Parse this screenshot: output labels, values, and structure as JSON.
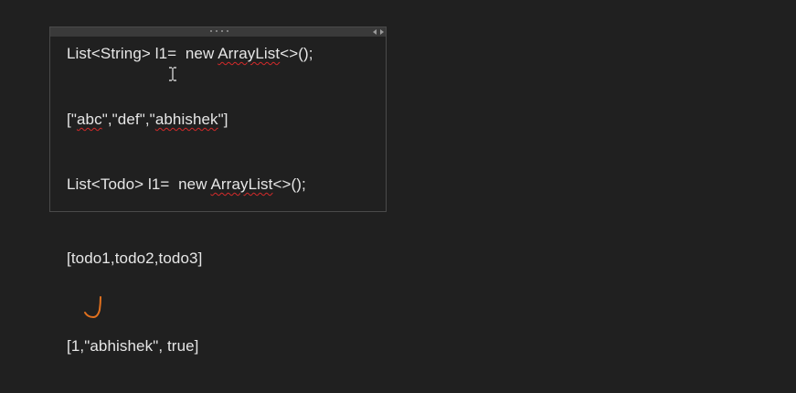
{
  "note_box": {
    "line1_prefix": "List<String> l1=  new ",
    "line1_squiggle": "ArrayList",
    "line1_suffix": "<>();",
    "line2_open": "[\"",
    "line2_abc": "abc",
    "line2_mid": "\",\"def\",\"",
    "line2_abhishek": "abhishek",
    "line2_close": "\"]",
    "line3_prefix": "List<Todo> l1=  new ",
    "line3_squiggle": "ArrayList",
    "line3_suffix": "<>();"
  },
  "page": {
    "todo_list": "[todo1,todo2,todo3]",
    "mixed_list_open": "[1,\"",
    "mixed_list_name": "abhishek",
    "mixed_list_close": "\", true]"
  },
  "icons": {
    "cursor": "text-cursor-icon",
    "check": "handwritten-check-icon"
  },
  "colors": {
    "background": "#202020",
    "text": "#e6e6e6",
    "spellcheck": "#d42a2a",
    "ink": "#e0701e"
  }
}
